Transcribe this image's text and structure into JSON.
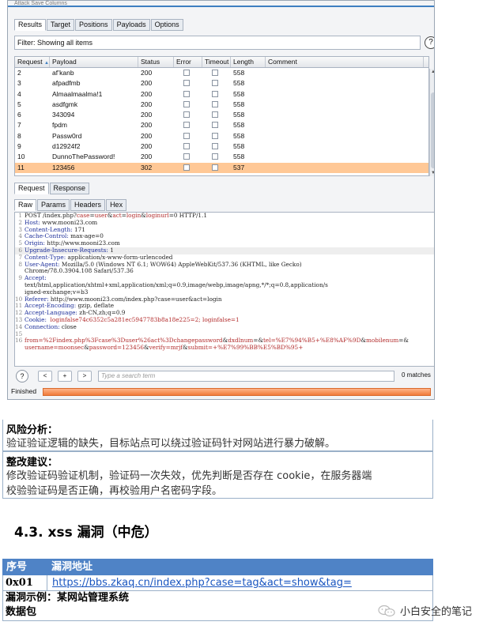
{
  "burp": {
    "menubar": "Attack  Save  Columns",
    "tabs": [
      "Results",
      "Target",
      "Positions",
      "Payloads",
      "Options"
    ],
    "filter_text": "Filter: Showing all items",
    "help_glyph": "?",
    "columns": [
      "Request",
      "Payload",
      "Status",
      "Error",
      "Timeout",
      "Length",
      "Comment"
    ],
    "sort_indicator": "▲",
    "rows": [
      {
        "req": "2",
        "payload": "af’kanb",
        "status": "200",
        "length": "558",
        "selected": false
      },
      {
        "req": "3",
        "payload": "afpadfmb",
        "status": "200",
        "length": "558",
        "selected": false
      },
      {
        "req": "4",
        "payload": "Almaalmaalma!1",
        "status": "200",
        "length": "558",
        "selected": false
      },
      {
        "req": "5",
        "payload": "asdfgmk",
        "status": "200",
        "length": "558",
        "selected": false
      },
      {
        "req": "6",
        "payload": "343094",
        "status": "200",
        "length": "558",
        "selected": false
      },
      {
        "req": "7",
        "payload": "fpdm",
        "status": "200",
        "length": "558",
        "selected": false
      },
      {
        "req": "8",
        "payload": "Passw0rd",
        "status": "200",
        "length": "558",
        "selected": false
      },
      {
        "req": "9",
        "payload": "d12924f2",
        "status": "200",
        "length": "558",
        "selected": false
      },
      {
        "req": "10",
        "payload": "DunnoThePassword!",
        "status": "200",
        "length": "558",
        "selected": false
      },
      {
        "req": "11",
        "payload": "123456",
        "status": "302",
        "length": "537",
        "selected": true
      }
    ],
    "req_resp_tabs": [
      "Request",
      "Response"
    ],
    "view_tabs": [
      "Raw",
      "Params",
      "Headers",
      "Hex"
    ],
    "request_lines": [
      {
        "n": "1",
        "segs": [
          [
            "POST /index.php?",
            ""
          ],
          [
            "case",
            "v"
          ],
          [
            "=",
            ""
          ],
          [
            "user",
            "v"
          ],
          [
            "&",
            ""
          ],
          [
            "act",
            "v"
          ],
          [
            "=",
            ""
          ],
          [
            "login",
            "v"
          ],
          [
            "&",
            ""
          ],
          [
            "loginurl",
            "v"
          ],
          [
            "=0 HTTP/1.1",
            ""
          ]
        ]
      },
      {
        "n": "2",
        "segs": [
          [
            "Host: ",
            "k"
          ],
          [
            "www.mooni23.com",
            ""
          ]
        ]
      },
      {
        "n": "3",
        "segs": [
          [
            "Content-Length: ",
            "k"
          ],
          [
            "171",
            ""
          ]
        ]
      },
      {
        "n": "4",
        "segs": [
          [
            "Cache-Control: ",
            "k"
          ],
          [
            "max-age=0",
            ""
          ]
        ]
      },
      {
        "n": "5",
        "segs": [
          [
            "Origin: ",
            "k"
          ],
          [
            "http://www.mooni23.com",
            ""
          ]
        ]
      },
      {
        "n": "6",
        "hl": true,
        "segs": [
          [
            "Upgrade-Insecure-Requests: ",
            "k"
          ],
          [
            "1",
            ""
          ]
        ]
      },
      {
        "n": "7",
        "segs": [
          [
            "Content-Type: ",
            "k"
          ],
          [
            "application/x-www-form-urlencoded",
            ""
          ]
        ]
      },
      {
        "n": "8",
        "segs": [
          [
            "User-Agent: ",
            "k"
          ],
          [
            "Mozilla/5.0 (Windows NT 6.1; WOW64) AppleWebKit/537.36 (KHTML, like Gecko)",
            ""
          ]
        ]
      },
      {
        "n": "",
        "segs": [
          [
            "Chrome/78.0.3904.108 Safari/537.36",
            ""
          ]
        ]
      },
      {
        "n": "9",
        "segs": [
          [
            "Accept:",
            "k"
          ]
        ]
      },
      {
        "n": "",
        "segs": [
          [
            "text/html,application/xhtml+xml,application/xml;q=0.9,image/webp,image/apng,*/*;q=0.8,application/s",
            ""
          ]
        ]
      },
      {
        "n": "",
        "segs": [
          [
            "igned-exchange;v=b3",
            ""
          ]
        ]
      },
      {
        "n": "10",
        "segs": [
          [
            "Referer: ",
            "k"
          ],
          [
            "http://www.mooni23.com/index.php?case=user&act=login",
            ""
          ]
        ]
      },
      {
        "n": "11",
        "segs": [
          [
            "Accept-Encoding: ",
            "k"
          ],
          [
            "gzip, deflate",
            ""
          ]
        ]
      },
      {
        "n": "12",
        "segs": [
          [
            "Accept-Language: ",
            "k"
          ],
          [
            "zh-CN,zh;q=0.9",
            ""
          ]
        ]
      },
      {
        "n": "13",
        "segs": [
          [
            "Cookie: ",
            "k"
          ],
          [
            " loginfalse74c6352c5a281ec5947783b8a18e225=2; loginfalse=1",
            "v"
          ]
        ]
      },
      {
        "n": "14",
        "segs": [
          [
            "Connection: ",
            "k"
          ],
          [
            "close",
            ""
          ]
        ]
      },
      {
        "n": "15",
        "segs": [
          [
            "",
            ""
          ]
        ]
      },
      {
        "n": "16",
        "segs": [
          [
            "from",
            "v"
          ],
          [
            "=%2Findex.php%3Fcase%3Duser%26act%3Dchangepassword",
            "v"
          ],
          [
            "&",
            ""
          ],
          [
            "dxdlnum",
            "v"
          ],
          [
            "=",
            ""
          ],
          [
            "&",
            ""
          ],
          [
            "tel",
            "v"
          ],
          [
            "=%E7%94%B5+%E8%AF%9D",
            "v"
          ],
          [
            "&",
            ""
          ],
          [
            "mobilenum",
            "v"
          ],
          [
            "=&",
            ""
          ]
        ]
      },
      {
        "n": "",
        "segs": [
          [
            "username",
            "v"
          ],
          [
            "=moonsec",
            "v"
          ],
          [
            "&",
            ""
          ],
          [
            "password",
            "v"
          ],
          [
            "=123456",
            "v"
          ],
          [
            "&",
            ""
          ],
          [
            "verify",
            "v"
          ],
          [
            "=mrjf",
            "v"
          ],
          [
            "&",
            ""
          ],
          [
            "submit",
            "v"
          ],
          [
            "=+%E7%99%BB%E5%BD%95+",
            "v"
          ]
        ]
      }
    ],
    "search_placeholder": "Type a search term",
    "nav_prev": "<",
    "nav_plus": "+",
    "nav_next": ">",
    "matches": "0 matches",
    "status": "Finished",
    "progress_fraction": 1.0
  },
  "risk": {
    "heading": "风险分析：",
    "text": "验证验证逻辑的缺失，目标站点可以绕过验证码针对网站进行暴力破解。"
  },
  "fix": {
    "heading": "整改建议：",
    "text_line1": "修改验证码验证机制，验证码一次失效，优先判断是否存在 cookie，在服务器端",
    "text_line2": "校验验证码是否正确，再校验用户名密码字段。"
  },
  "section": {
    "title": "4.3. xss 漏洞（中危）"
  },
  "vuln_table": {
    "col_id": "序号",
    "col_url": "漏洞地址",
    "rows": [
      {
        "id": "0x01",
        "url": "https://bbs.zkaq.cn/index.php?case=tag&act=show&tag="
      }
    ],
    "example_label": "漏洞示例：某网站管理系统",
    "packet_label": "数据包"
  },
  "watermark": {
    "text": "小白安全的笔记",
    "icon": "wechat-icon",
    "icon_color": "#bbbbbb"
  }
}
